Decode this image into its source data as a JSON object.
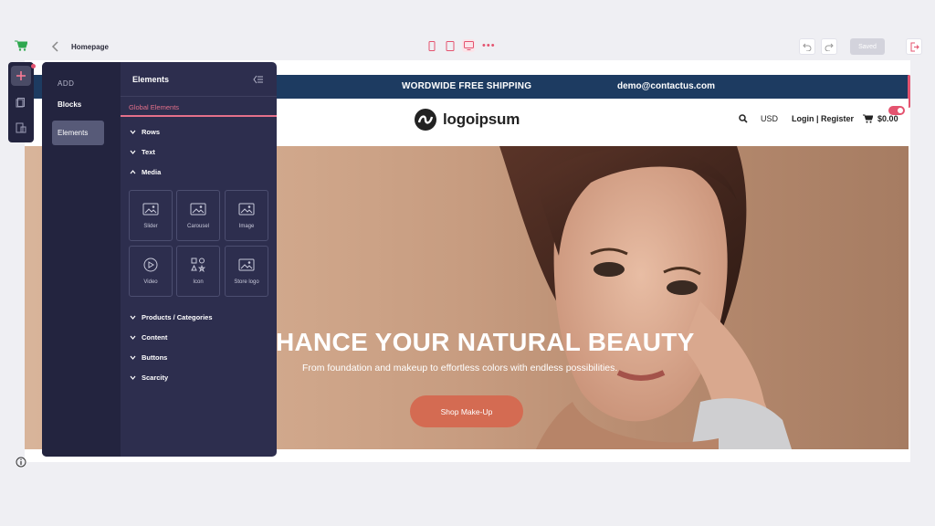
{
  "topbar": {
    "page_name": "Homepage",
    "saved_label": "Saved"
  },
  "site": {
    "announcement_shipping": "WORDWIDE FREE SHIPPING",
    "announcement_email": "demo@contactus.com",
    "brand_name": "logoipsum",
    "currency": "USD",
    "login_register": "Login | Register",
    "cart_total": "$0.00",
    "hero_title": "HANCE YOUR NATURAL BEAUTY",
    "hero_subtitle": "From foundation and makeup to effortless colors with endless possibilities.",
    "hero_button": "Shop Make-Up",
    "colors": {
      "announcement_bg": "#1d3b61",
      "accent": "#d46b52"
    }
  },
  "panel": {
    "add_label": "ADD",
    "tabs": {
      "blocks": "Blocks",
      "elements": "Elements"
    },
    "title": "Elements",
    "global_label": "Global Elements",
    "categories": {
      "rows": "Rows",
      "text": "Text",
      "media": "Media",
      "products": "Products / Categories",
      "content": "Content",
      "buttons": "Buttons",
      "scarcity": "Scarcity"
    },
    "media_tiles": {
      "slider": "Slider",
      "carousel": "Carousel",
      "image": "Image",
      "video": "Video",
      "icon": "Icon",
      "store_logo": "Store logo"
    },
    "colors": {
      "accent": "#e4708a",
      "panel_bg": "#2d2e4e"
    }
  }
}
